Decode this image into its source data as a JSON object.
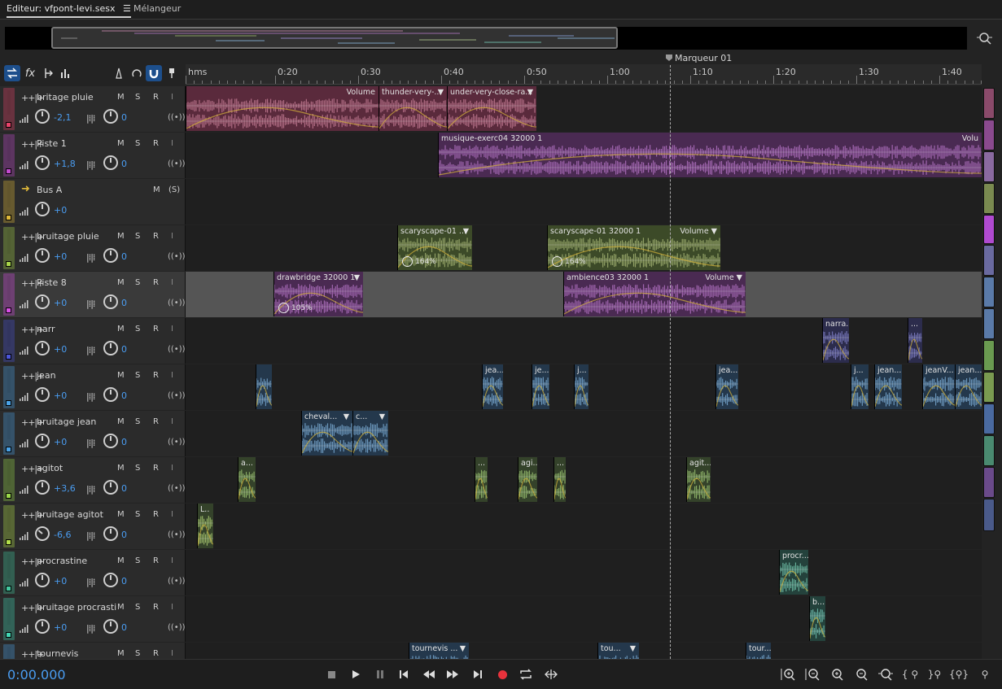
{
  "tabs": {
    "editor": "Editeur: vfpont-levi.sesx",
    "editor_menu": "☰",
    "mixer": "Mélangeur"
  },
  "ruler": {
    "ticks": [
      "hms",
      "0:20",
      "0:30",
      "0:40",
      "0:50",
      "1:00",
      "1:10",
      "1:20",
      "1:30",
      "1:40"
    ]
  },
  "marker": {
    "label": "Marqueur 01"
  },
  "tracks": [
    {
      "name": "britage pluie",
      "color": "#e8436a",
      "vol": "-2,1",
      "pan": "0",
      "type": "audio",
      "clips": [
        {
          "title": "",
          "vol": "Volume"
        },
        {
          "title": "thunder-very-...",
          "vol": "▼"
        },
        {
          "title": "under-very-close-ra...",
          "vol": "▼"
        }
      ]
    },
    {
      "name": "Piste 1",
      "color": "#c34ad0",
      "vol": "+1,8",
      "pan": "0",
      "type": "audio",
      "clips": [
        {
          "title": "musique-exerc04 32000 1",
          "vol": "Volu"
        }
      ]
    },
    {
      "name": "Bus A",
      "color": "#e0b93a",
      "vol": "+0",
      "type": "bus",
      "solo": "(S)"
    },
    {
      "name": "bruitage pluie",
      "color": "#a9d64a",
      "vol": "+0",
      "pan": "0",
      "type": "audio",
      "clips": [
        {
          "title": "scaryscape-01 ...",
          "vol": "▼",
          "stretch": "164%"
        },
        {
          "title": "scaryscape-01 32000 1",
          "vol": "Volume  ▼",
          "stretch": "164%"
        }
      ]
    },
    {
      "name": "Piste 8",
      "color": "#d94ee6",
      "vol": "+0",
      "pan": "0",
      "type": "audio",
      "clips": [
        {
          "title": "drawbridge 32000 1",
          "vol": "▼",
          "stretch": "105%"
        },
        {
          "title": "ambience03 32000 1",
          "vol": "Volume  ▼"
        }
      ]
    },
    {
      "name": "narr",
      "color": "#4b55d9",
      "vol": "+0",
      "pan": "0",
      "type": "audio",
      "clips": [
        {
          "title": "narra..."
        },
        {
          "title": "..."
        }
      ]
    },
    {
      "name": "jean",
      "color": "#4aa3e8",
      "vol": "+0",
      "pan": "0",
      "type": "audio",
      "clips": [
        {
          "title": ""
        },
        {
          "title": "jea..."
        },
        {
          "title": "je..."
        },
        {
          "title": "j..."
        },
        {
          "title": "jea..."
        },
        {
          "title": "j..."
        },
        {
          "title": "jean..."
        },
        {
          "title": "jeanV..."
        },
        {
          "title": "jean..."
        }
      ]
    },
    {
      "name": "bruitage jean",
      "color": "#4aa3e8",
      "vol": "+0",
      "pan": "0",
      "type": "audio",
      "clips": [
        {
          "title": "cheval...",
          "vol": "▼"
        },
        {
          "title": "c...",
          "vol": "▼"
        }
      ]
    },
    {
      "name": "agitot",
      "color": "#9ad84a",
      "vol": "+3,6",
      "pan": "0",
      "type": "audio",
      "clips": [
        {
          "title": "a..."
        },
        {
          "title": "..."
        },
        {
          "title": "agi..."
        },
        {
          "title": "..."
        },
        {
          "title": "agit..."
        }
      ]
    },
    {
      "name": "bruitage agitot",
      "color": "#b4e04a",
      "vol": "-6,6",
      "pan": "0",
      "type": "audio",
      "clips": [
        {
          "title": "L.."
        }
      ]
    },
    {
      "name": "procrastine",
      "color": "#43c9a0",
      "vol": "+0",
      "pan": "0",
      "type": "audio",
      "clips": [
        {
          "title": "procr..."
        }
      ]
    },
    {
      "name": "bruitage procrasti",
      "color": "#43d6b4",
      "vol": "+0",
      "pan": "0",
      "type": "audio",
      "clips": [
        {
          "title": "b..."
        }
      ]
    },
    {
      "name": "tournevis",
      "color": "#4aa3e8",
      "type": "audio",
      "clips": [
        {
          "title": "tournevis ...",
          "vol": "▼"
        },
        {
          "title": "tou...",
          "vol": "▼"
        },
        {
          "title": "tour..."
        }
      ]
    }
  ],
  "transport": {
    "time": "0:00.000"
  },
  "colors": {
    "accent": "#4a9df2",
    "selected_track": "#555555"
  }
}
